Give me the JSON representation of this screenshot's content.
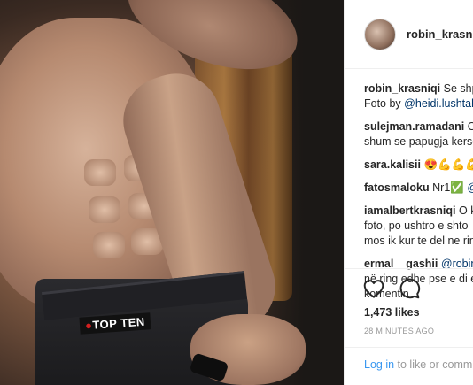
{
  "post": {
    "username": "robin_krasniq",
    "brand_print": "TOP TEN"
  },
  "comments": [
    {
      "user": "robin_krasniqi",
      "text": "Se shpo",
      "line2_prefix": "Foto by ",
      "line2_mention": "@heidi.lushtal"
    },
    {
      "user": "sulejman.ramadani",
      "text": "Oc",
      "line2": "shum se papugja kerse"
    },
    {
      "user": "sara.kalisii",
      "text": "😍💪💪💪"
    },
    {
      "user": "fatosmaloku",
      "text": "Nr1✅",
      "mention": "@"
    },
    {
      "user": "iamalbertkrasniqi",
      "text": "O k",
      "line2": "foto, po ushtro e shto",
      "line3": "mos ik kur te del ne rin"
    },
    {
      "user": "ermal__gashii",
      "text": "",
      "mention": "@robin_",
      "line2": "në ring edhe pse e di e",
      "line3": "komentin"
    }
  ],
  "actions": {
    "like_icon": "heart-icon",
    "comment_icon": "comment-bubble-icon"
  },
  "likes": "1,473 likes",
  "timestamp": "28 MINUTES AGO",
  "login": {
    "link": "Log in",
    "rest": " to like or comm"
  }
}
